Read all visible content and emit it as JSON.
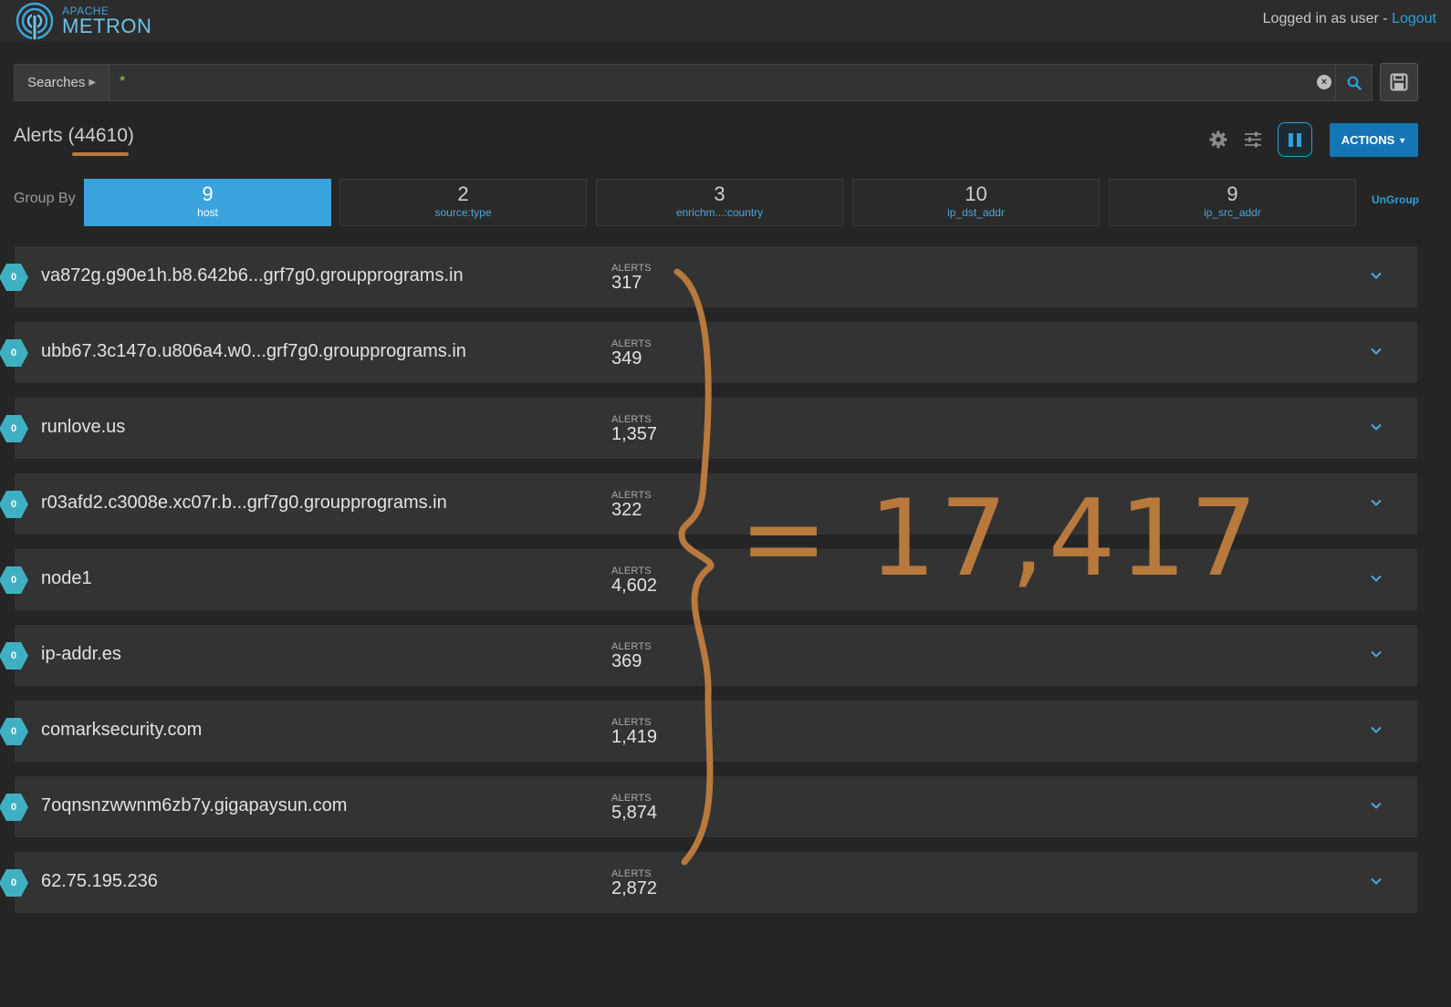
{
  "header": {
    "logo_small": "APACHE",
    "logo_big": "METRON",
    "login_prefix": "Logged in as user - ",
    "logout_label": "Logout"
  },
  "search": {
    "searches_label": "Searches",
    "query": "*"
  },
  "alerts": {
    "title_prefix": "Alerts (",
    "count": "44610",
    "title_suffix": ")"
  },
  "toolbar": {
    "actions_label": "ACTIONS"
  },
  "group_by": {
    "label": "Group By",
    "ungroup_label": "UnGroup",
    "tiles": [
      {
        "count": "9",
        "name": "host",
        "active": true
      },
      {
        "count": "2",
        "name": "source:type",
        "active": false
      },
      {
        "count": "3",
        "name": "enrichm...:country",
        "active": false
      },
      {
        "count": "10",
        "name": "ip_dst_addr",
        "active": false
      },
      {
        "count": "9",
        "name": "ip_src_addr",
        "active": false
      }
    ]
  },
  "rows": [
    {
      "badge": "0",
      "host": "va872g.g90e1h.b8.642b6...grf7g0.groupprograms.in",
      "alerts_label": "ALERTS",
      "alerts": "317"
    },
    {
      "badge": "0",
      "host": "ubb67.3c147o.u806a4.w0...grf7g0.groupprograms.in",
      "alerts_label": "ALERTS",
      "alerts": "349"
    },
    {
      "badge": "0",
      "host": "runlove.us",
      "alerts_label": "ALERTS",
      "alerts": "1,357"
    },
    {
      "badge": "0",
      "host": "r03afd2.c3008e.xc07r.b...grf7g0.groupprograms.in",
      "alerts_label": "ALERTS",
      "alerts": "322"
    },
    {
      "badge": "0",
      "host": "node1",
      "alerts_label": "ALERTS",
      "alerts": "4,602"
    },
    {
      "badge": "0",
      "host": "ip-addr.es",
      "alerts_label": "ALERTS",
      "alerts": "369"
    },
    {
      "badge": "0",
      "host": "comarksecurity.com",
      "alerts_label": "ALERTS",
      "alerts": "1,419"
    },
    {
      "badge": "0",
      "host": "7oqnsnzwwnm6zb7y.gigapaysun.com",
      "alerts_label": "ALERTS",
      "alerts": "5,874"
    },
    {
      "badge": "0",
      "host": "62.75.195.236",
      "alerts_label": "ALERTS",
      "alerts": "2,872"
    }
  ],
  "annotation": {
    "text": "= 17,417",
    "color": "#b8793d"
  },
  "colors": {
    "accent": "#2f9fd8",
    "active_tile": "#3aa3dd",
    "badge": "#3fb0c2",
    "background": "#252525",
    "row": "#333333"
  }
}
